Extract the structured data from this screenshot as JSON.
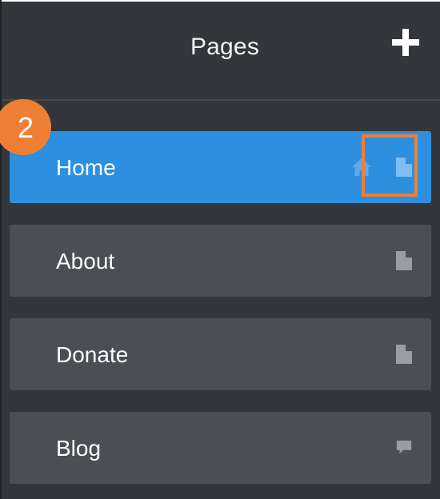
{
  "header": {
    "title": "Pages",
    "add_icon": "plus-icon"
  },
  "pages": [
    {
      "label": "Home",
      "active": true,
      "icons": [
        "home-icon",
        "page-icon"
      ]
    },
    {
      "label": "About",
      "active": false,
      "icons": [
        "page-icon"
      ]
    },
    {
      "label": "Donate",
      "active": false,
      "icons": [
        "page-icon"
      ]
    },
    {
      "label": "Blog",
      "active": false,
      "icons": [
        "comment-icon"
      ]
    }
  ],
  "annotation": {
    "step_number": "2",
    "color": "#ef7f35"
  },
  "colors": {
    "panel_bg": "#33373b",
    "item_bg": "#4a4f54",
    "active_bg": "#2d8fe0"
  }
}
